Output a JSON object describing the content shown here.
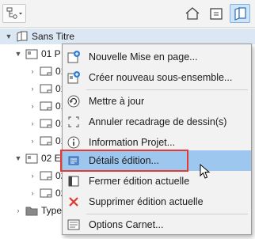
{
  "toolbar": {
    "buttons": [
      {
        "name": "view-dropdown",
        "icon": "tree-settings-icon"
      },
      {
        "name": "home-view",
        "icon": "house-icon"
      },
      {
        "name": "folder-view",
        "icon": "folder-icon"
      },
      {
        "name": "book-view",
        "icon": "layout-book-icon",
        "selected": true
      }
    ]
  },
  "tree": {
    "root": {
      "label": "Sans Titre",
      "icon": "book-icon"
    },
    "rows": [
      {
        "label": "01 P",
        "icon": "subset-icon",
        "level": 1,
        "expanded": true
      },
      {
        "label": "01",
        "icon": "layout-icon",
        "level": 2
      },
      {
        "label": "01",
        "icon": "layout-icon",
        "level": 2
      },
      {
        "label": "01",
        "icon": "layout-icon",
        "level": 2
      },
      {
        "label": "01",
        "icon": "layout-icon",
        "level": 2
      },
      {
        "label": "01",
        "icon": "layout-icon",
        "level": 2
      },
      {
        "label": "02 E",
        "icon": "subset-icon",
        "level": 1,
        "expanded": true
      },
      {
        "label": "02",
        "icon": "layout-icon",
        "level": 2
      },
      {
        "label": "02",
        "icon": "layout-icon",
        "level": 2
      },
      {
        "label": "Type",
        "icon": "folder-icon",
        "level": 1,
        "expanded": false
      }
    ]
  },
  "context_menu": {
    "items": [
      {
        "label": "Nouvelle Mise en page...",
        "icon": "new-layout-icon"
      },
      {
        "label": "Créer nouveau sous-ensemble...",
        "icon": "new-subset-icon"
      },
      {
        "label": "Mettre à jour",
        "icon": "refresh-icon"
      },
      {
        "label": "Annuler recadrage de dessin(s)",
        "icon": "crop-corners-icon"
      },
      {
        "label": "Information Projet...",
        "icon": "info-icon"
      },
      {
        "label": "Détails édition...",
        "icon": "edition-details-icon",
        "highlighted": true
      },
      {
        "label": "Fermer édition actuelle",
        "icon": "close-edition-icon"
      },
      {
        "label": "Supprimer édition actuelle",
        "icon": "red-x-icon"
      },
      {
        "label": "Options Carnet...",
        "icon": "options-icon"
      }
    ]
  },
  "colors": {
    "highlight": "#9ec7ef",
    "annotation_box": "#e53935",
    "selected_tool": "#cfe4f7",
    "root_row": "#dbe7f3"
  }
}
